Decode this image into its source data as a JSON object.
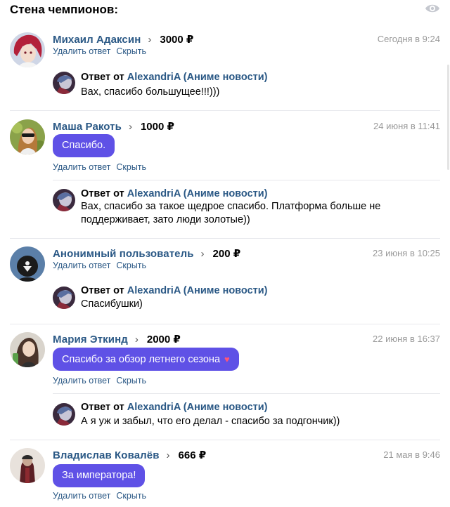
{
  "header": {
    "title": "Стена чемпионов:"
  },
  "reply_prefix": "Ответ от",
  "reply_author": "AlexandriA (Аниме новости)",
  "delete_label": "Удалить ответ",
  "hide_label": "Скрыть",
  "entries": [
    {
      "name": "Михаил Адаксин",
      "amount": "3000 ₽",
      "date": "Сегодня в 9:24",
      "message": null,
      "reply_text": "Вах, спасибо большущее!!!)))"
    },
    {
      "name": "Маша Ракоть",
      "amount": "1000 ₽",
      "date": "24 июня в 11:41",
      "message": "Спасибо.",
      "reply_text": "Вах, спасибо за такое щедрое спасибо. Платформа больше не поддерживает, зато люди золотые))"
    },
    {
      "name": "Анонимный пользователь",
      "amount": "200 ₽",
      "date": "23 июня в 10:25",
      "message": null,
      "reply_text": "Спасибушки)"
    },
    {
      "name": "Мария Эткинд",
      "amount": "2000 ₽",
      "date": "22 июня в 16:37",
      "message": "Спасибо за обзор летнего сезона",
      "reply_text": "А я уж и забыл, что его делал - спасибо за подгончик))"
    },
    {
      "name": "Владислав Ковалёв",
      "amount": "666 ₽",
      "date": "21 мая в 9:46",
      "message": "За императора!",
      "reply_text": null
    }
  ]
}
